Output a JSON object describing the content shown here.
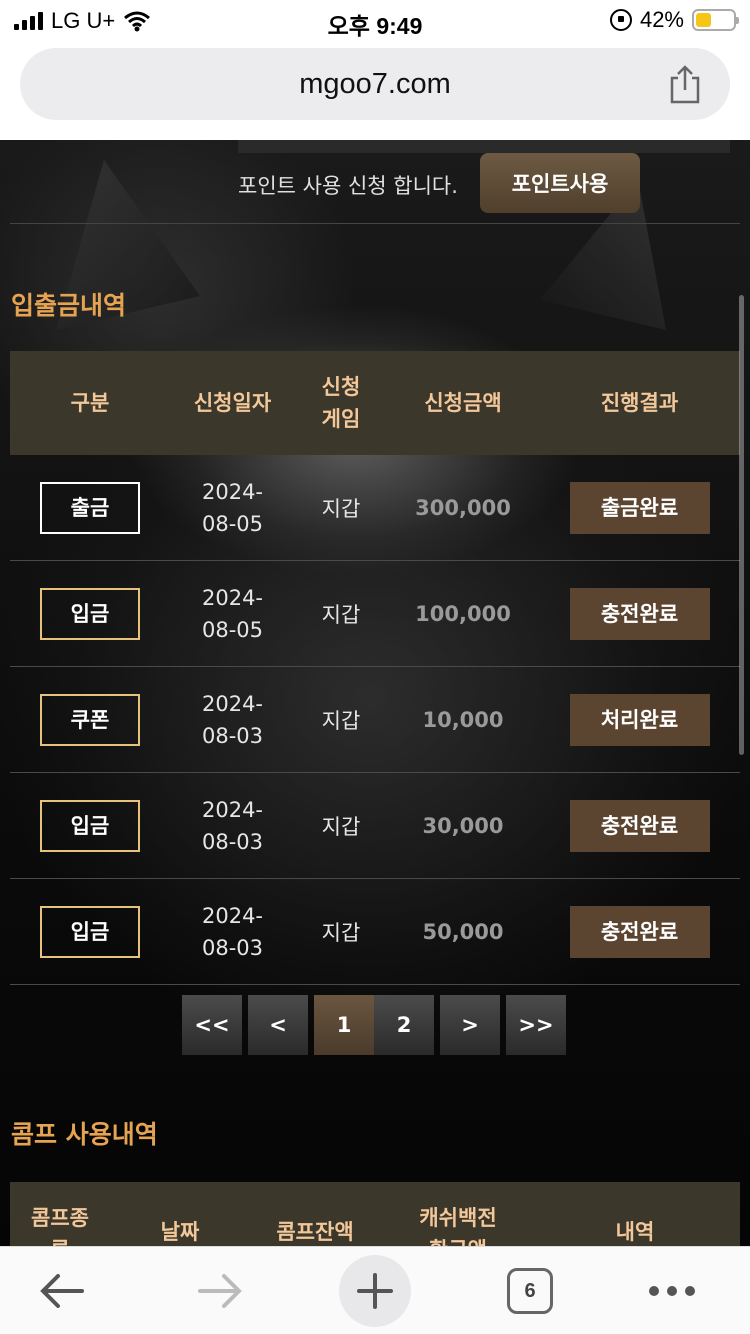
{
  "status_bar": {
    "carrier": "LG U+",
    "time": "오후 9:49",
    "battery": "42%",
    "battery_level": 0.42
  },
  "browser": {
    "url": "mgoo7.com",
    "tab_count": "6"
  },
  "point": {
    "text": "포인트 사용 신청 합니다.",
    "button_label": "포인트사용"
  },
  "transactions": {
    "title": "입출금내역",
    "headers": [
      "구분",
      "신청일자",
      "신청\n게임",
      "신청금액",
      "진행결과"
    ],
    "rows": [
      {
        "type": "출금",
        "date": "2024-\n08-05",
        "game": "지갑",
        "amount": "300,000",
        "status": "출금완료"
      },
      {
        "type": "입금",
        "date": "2024-\n08-05",
        "game": "지갑",
        "amount": "100,000",
        "status": "충전완료"
      },
      {
        "type": "쿠폰",
        "date": "2024-\n08-03",
        "game": "지갑",
        "amount": "10,000",
        "status": "처리완료"
      },
      {
        "type": "입금",
        "date": "2024-\n08-03",
        "game": "지갑",
        "amount": "30,000",
        "status": "충전완료"
      },
      {
        "type": "입금",
        "date": "2024-\n08-03",
        "game": "지갑",
        "amount": "50,000",
        "status": "충전완료"
      }
    ]
  },
  "pagination": {
    "first": "<<",
    "prev": "<",
    "pages": [
      "1",
      "2"
    ],
    "current": "1",
    "next": ">",
    "last": ">>"
  },
  "comp": {
    "title": "콤프 사용내역",
    "headers": [
      "콤프종\n류",
      "날짜",
      "콤프잔액",
      "캐쉬백전\n환금액",
      "내역"
    ]
  }
}
